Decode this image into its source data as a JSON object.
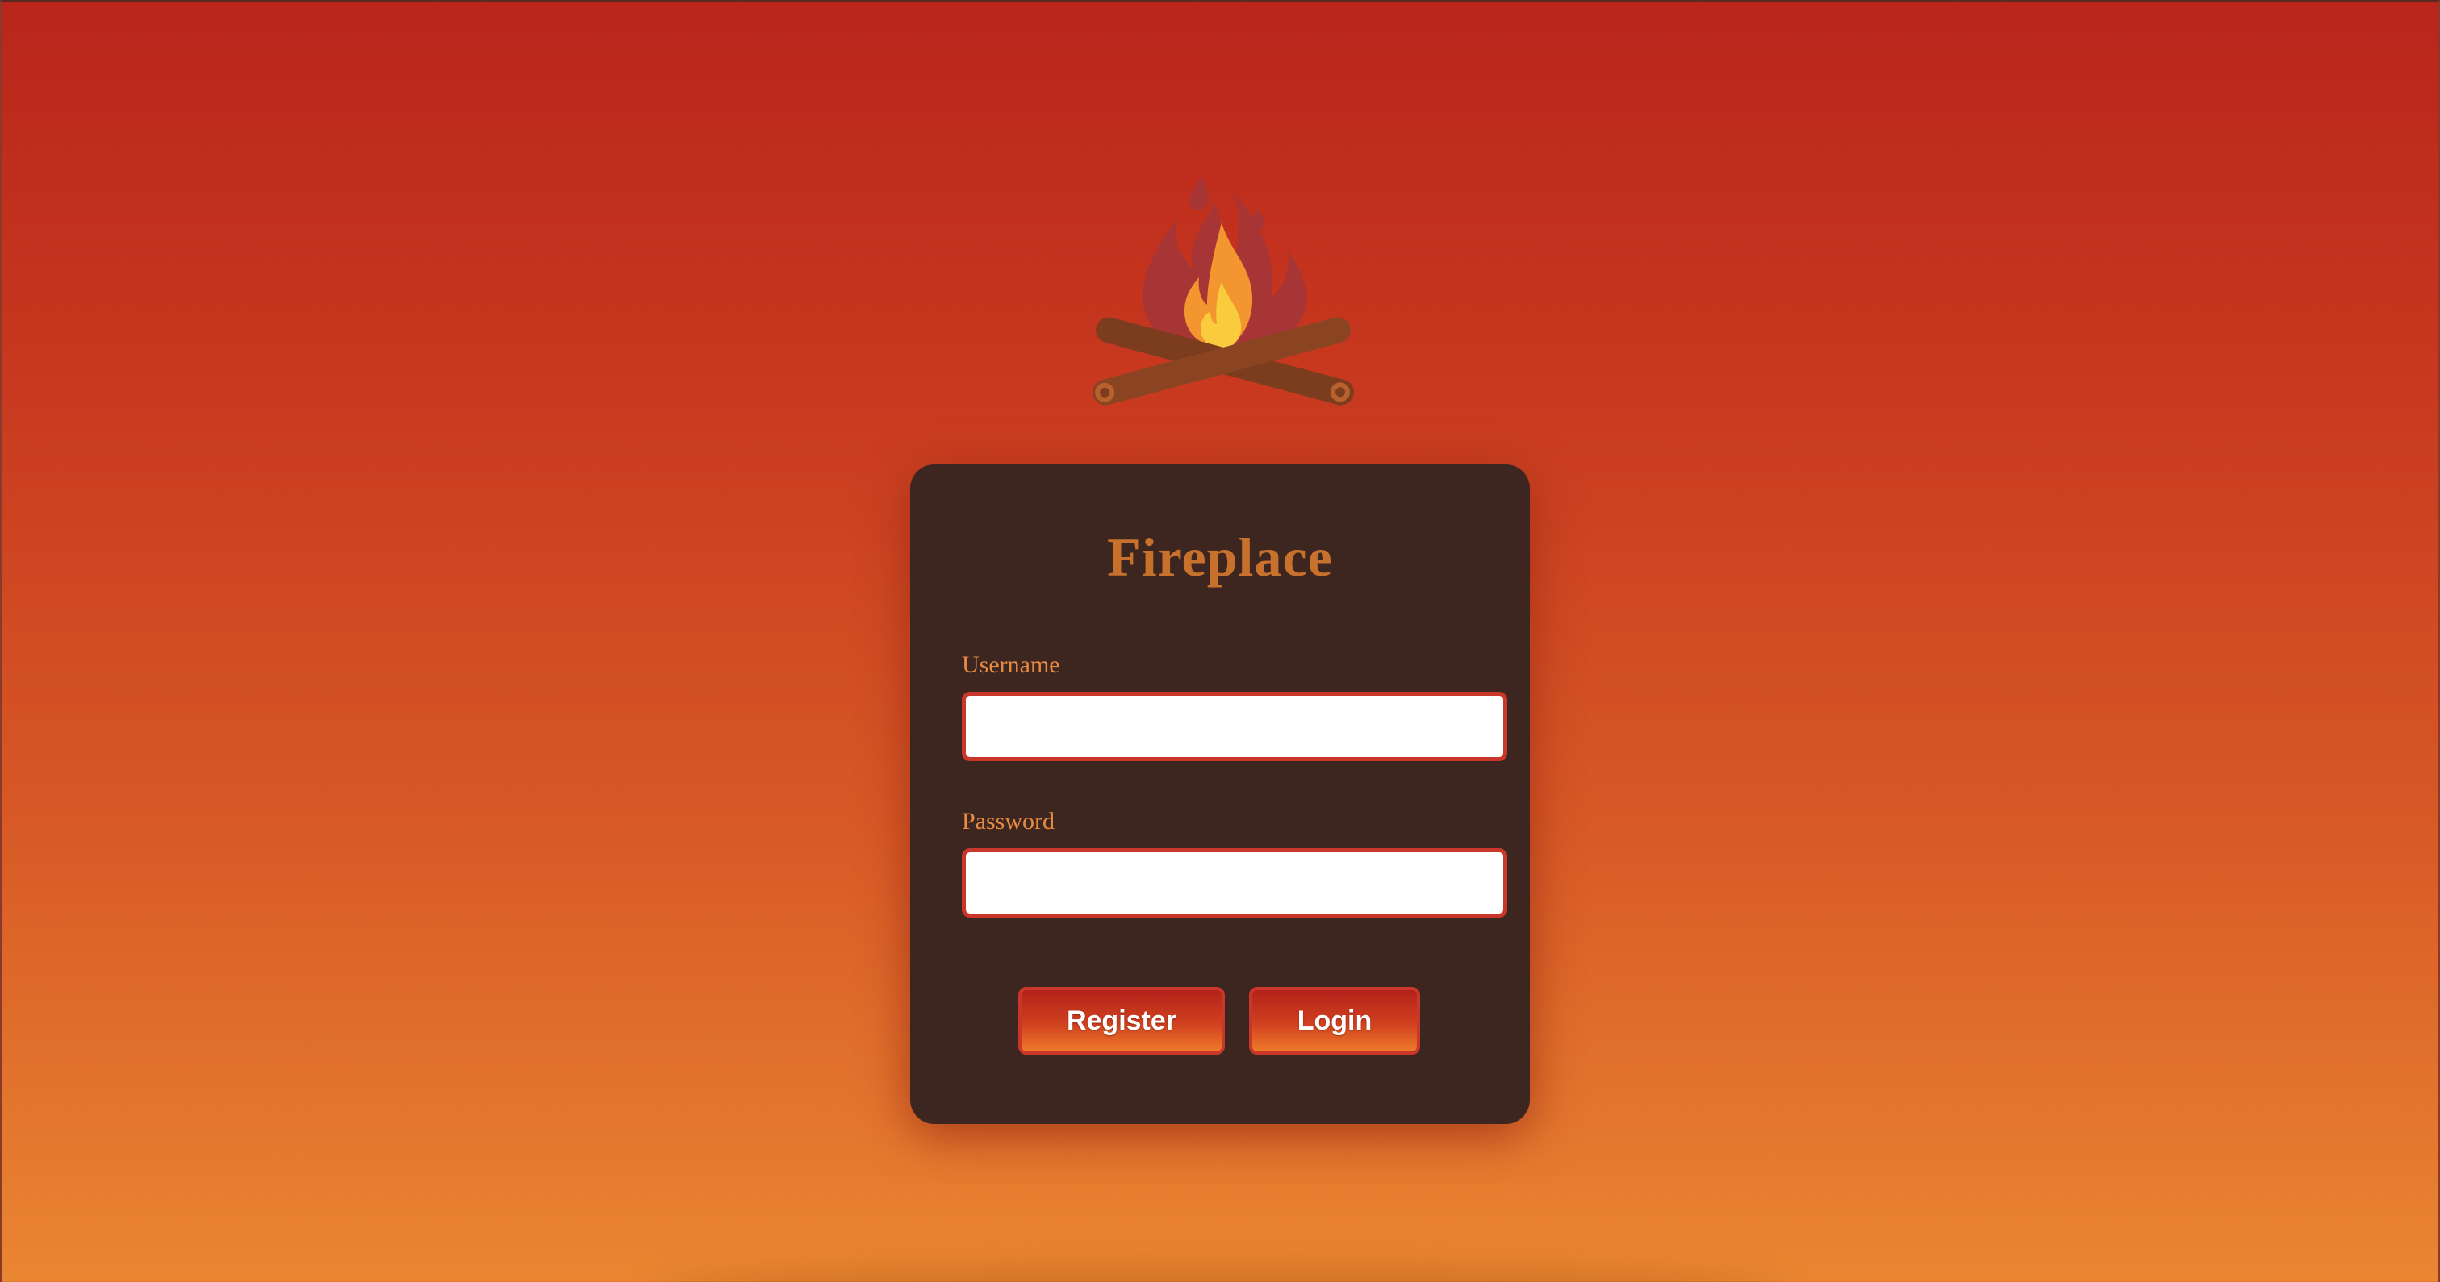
{
  "app": {
    "title": "Fireplace"
  },
  "theme": {
    "background_top": "#b9251b",
    "background_bottom": "#ea8632",
    "card_background": "#3e2620",
    "title_color": "#c7712d",
    "label_color": "#e78a42",
    "input_border": "#c8372a",
    "button_text": "#ffffff"
  },
  "logo": {
    "icon": "campfire-icon"
  },
  "login_form": {
    "username": {
      "label": "Username",
      "value": "",
      "placeholder": ""
    },
    "password": {
      "label": "Password",
      "value": "",
      "placeholder": ""
    },
    "buttons": {
      "register_label": "Register",
      "login_label": "Login"
    }
  }
}
